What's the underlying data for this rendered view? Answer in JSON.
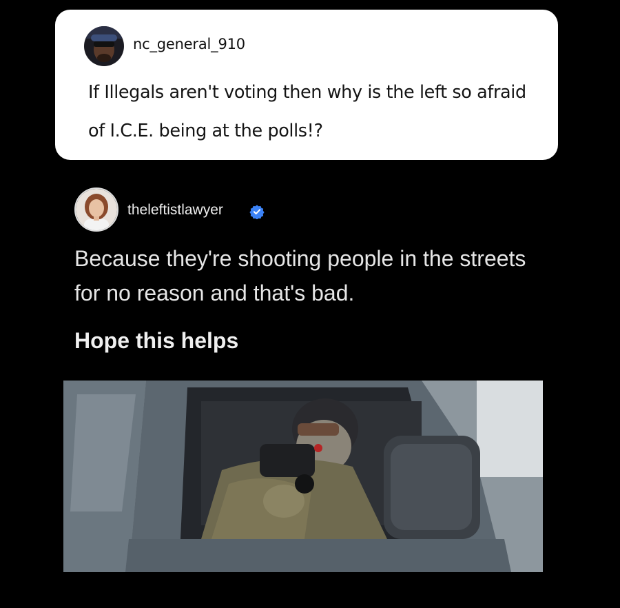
{
  "quoted_post": {
    "username": "nc_general_910",
    "text": "If Illegals aren't voting then why is the left so afraid of I.C.E. being at the polls!?"
  },
  "reply": {
    "username": "theleftistlawyer",
    "verified": true,
    "text": "Because they're shooting people in the streets for no reason and that's bad.",
    "closing": "Hope this helps"
  },
  "colors": {
    "background": "#000000",
    "card_background": "#ffffff",
    "verified_badge": "#3b82f6"
  },
  "icons": {
    "verified": "verified-badge-icon"
  }
}
